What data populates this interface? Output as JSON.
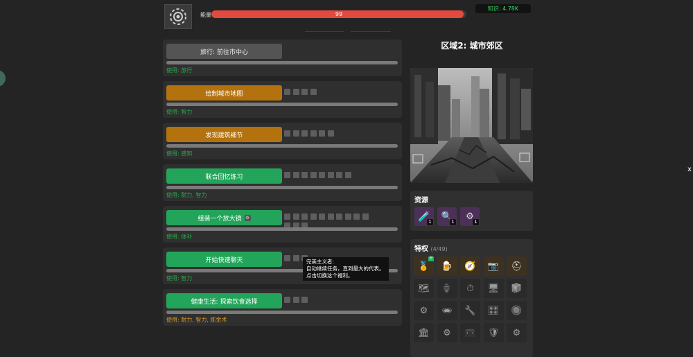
{
  "header": {
    "energy_label": "能量",
    "energy_value": "99",
    "energy_fraction": 0.99,
    "knowledge": "知识: 4.78K"
  },
  "tasks": [
    {
      "label": "旅行: 前往市中心",
      "style": "gray",
      "uses": "使用: 旅行",
      "uses_color": "green",
      "squares": 0,
      "progress": 0
    },
    {
      "label": "绘制城市地图",
      "style": "orange",
      "uses": "使用: 智力",
      "uses_color": "green",
      "squares": 4,
      "progress": 0
    },
    {
      "label": "发现建筑细节",
      "style": "orange",
      "uses": "使用: 感知",
      "uses_color": "green",
      "squares": 6,
      "progress": 0
    },
    {
      "label": "联合回忆练习",
      "style": "green",
      "uses": "使用: 耐力, 智力",
      "uses_color": "green",
      "squares": 8,
      "progress": 0
    },
    {
      "label": "组装一个放大镜",
      "style": "green",
      "uses": "使用: 体补",
      "uses_color": "green",
      "squares": 13,
      "progress": 0,
      "icon": "tool-icon"
    },
    {
      "label": "开始快速聊天",
      "style": "green",
      "uses": "使用: 智力",
      "uses_color": "green",
      "squares": 3,
      "progress": 0
    },
    {
      "label": "健康生活: 探索饮食选择",
      "style": "green",
      "uses": "使用: 耐力, 智力, 炼金术",
      "uses_color": "orange",
      "squares": 3,
      "progress": 0
    }
  ],
  "tooltip": {
    "title": "完美主义者:",
    "line1": "自动继续任务，直到最大的代表。",
    "line2": "点击切换这个福利。"
  },
  "region": {
    "title": "区域2: 城市郊区",
    "image_alt": "ruined-city-street-image"
  },
  "resources": {
    "title": "资源",
    "items": [
      {
        "icon": "potion-icon",
        "count": "1"
      },
      {
        "icon": "magnifier-icon",
        "count": "1"
      },
      {
        "icon": "gears-icon",
        "count": "1"
      }
    ]
  },
  "perks": {
    "title": "特权",
    "count": "(4/49)",
    "badge": "开",
    "active_count": 5,
    "total_visible": 20
  },
  "misc": {
    "close": "x"
  },
  "colors": {
    "energy": "#e24a40",
    "knowledge": "#3fdc6a",
    "green_button": "#22a55a",
    "orange_button": "#b3720e",
    "uses_green": "#2fa650",
    "uses_orange": "#d89a22"
  }
}
